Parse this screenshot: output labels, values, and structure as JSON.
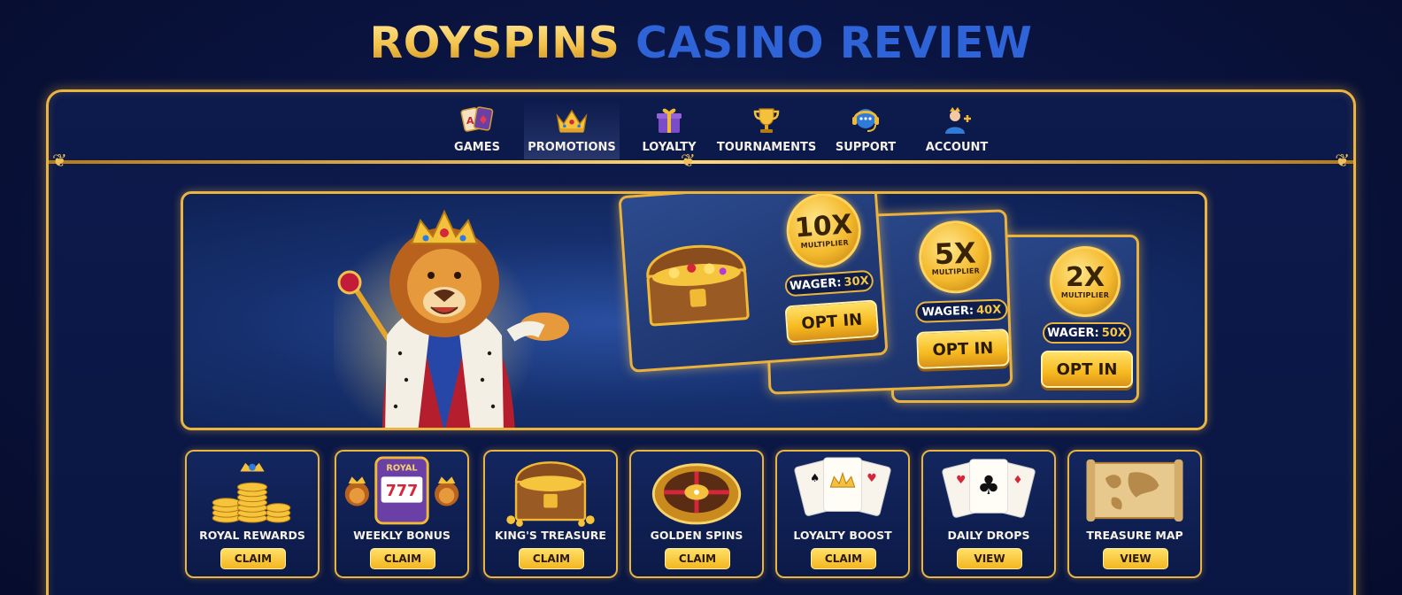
{
  "title": {
    "part1": "ROYSPINS",
    "part2": "CASINO REVIEW"
  },
  "colors": {
    "gold": "#e9b442",
    "blue_title": "#2f63d8",
    "background": "#0a1440",
    "button": "#f6b91f"
  },
  "nav": {
    "active": "PROMOTIONS",
    "items": [
      {
        "label": "GAMES",
        "icon": "playing-cards-icon"
      },
      {
        "label": "PROMOTIONS",
        "icon": "crown-icon"
      },
      {
        "label": "LOYALTY",
        "icon": "gift-box-icon"
      },
      {
        "label": "TOURNAMENTS",
        "icon": "trophy-icon"
      },
      {
        "label": "SUPPORT",
        "icon": "chat-headset-icon"
      },
      {
        "label": "ACCOUNT",
        "icon": "user-add-icon"
      }
    ]
  },
  "hero": {
    "mascot": "lion-king-mascot",
    "offers": [
      {
        "multiplier": "10X",
        "multiplier_label": "MULTIPLIER",
        "wager_label": "WAGER:",
        "wager_value": "30X",
        "button": "OPT IN"
      },
      {
        "multiplier": "5X",
        "multiplier_label": "MULTIPLIER",
        "wager_label": "WAGER:",
        "wager_value": "40X",
        "button": "OPT IN"
      },
      {
        "multiplier": "2X",
        "multiplier_label": "MULTIPLIER",
        "wager_label": "WAGER:",
        "wager_value": "50X",
        "button": "OPT IN"
      }
    ]
  },
  "tiles": [
    {
      "label": "ROYAL REWARDS",
      "button": "CLAIM",
      "icon": "coin-stacks-icon"
    },
    {
      "label": "WEEKLY BONUS",
      "button": "CLAIM",
      "icon": "slot-machine-icon",
      "art_text": "ROYAL",
      "reels": "777"
    },
    {
      "label": "KING'S TREASURE",
      "button": "CLAIM",
      "icon": "treasure-chest-icon"
    },
    {
      "label": "GOLDEN SPINS",
      "button": "CLAIM",
      "icon": "roulette-wheel-icon"
    },
    {
      "label": "LOYALTY BOOST",
      "button": "CLAIM",
      "icon": "crown-cards-icon"
    },
    {
      "label": "DAILY DROPS",
      "button": "VIEW",
      "icon": "playing-cards-icon"
    },
    {
      "label": "TREASURE MAP",
      "button": "VIEW",
      "icon": "map-scroll-icon"
    }
  ]
}
